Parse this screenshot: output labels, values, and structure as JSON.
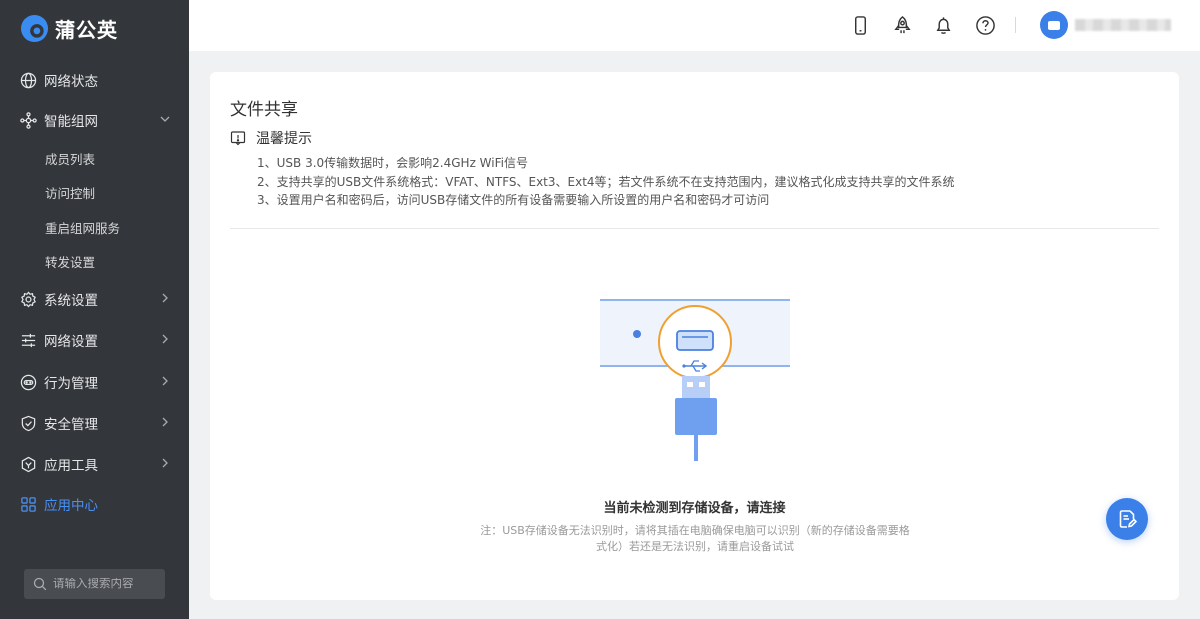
{
  "app": {
    "brand_name": "蒲公英"
  },
  "sidebar": {
    "items": [
      {
        "label": "网络状态",
        "icon": "globe-icon"
      },
      {
        "label": "智能组网",
        "icon": "network-icon",
        "expanded": true,
        "children": [
          {
            "label": "成员列表"
          },
          {
            "label": "访问控制"
          },
          {
            "label": "重启组网服务"
          },
          {
            "label": "转发设置"
          }
        ]
      },
      {
        "label": "系统设置",
        "icon": "gear-icon"
      },
      {
        "label": "网络设置",
        "icon": "sliders-icon"
      },
      {
        "label": "行为管理",
        "icon": "behavior-icon"
      },
      {
        "label": "安全管理",
        "icon": "shield-icon"
      },
      {
        "label": "应用工具",
        "icon": "tools-icon"
      },
      {
        "label": "应用中心",
        "icon": "grid-icon",
        "active": true
      }
    ],
    "search_placeholder": "请输入搜索内容"
  },
  "topbar": {
    "icons": [
      "phone-icon",
      "rocket-icon",
      "bell-icon",
      "help-icon"
    ]
  },
  "main": {
    "title": "文件共享",
    "tips": {
      "title": "温馨提示",
      "lines": [
        "1、USB 3.0传输数据时，会影响2.4GHz WiFi信号",
        "2、支持共享的USB文件系统格式：VFAT、NTFS、Ext3、Ext4等；若文件系统不在支持范围内，建议格式化成支持共享的文件系统",
        "3、设置用户名和密码后，访问USB存储文件的所有设备需要输入所设置的用户名和密码才可访问"
      ]
    },
    "empty": {
      "title": "当前未检测到存储设备，请连接",
      "note": "注：USB存储设备无法识别时，请将其插在电脑确保电脑可以识别（新的存储设备需要格式化）若还是无法识别，请重启设备试试"
    }
  },
  "colors": {
    "sidebar_bg": "#33363a",
    "accent": "#3b7fe8",
    "active_nav": "#4a8ff2",
    "usb_ring": "#f0a030"
  }
}
